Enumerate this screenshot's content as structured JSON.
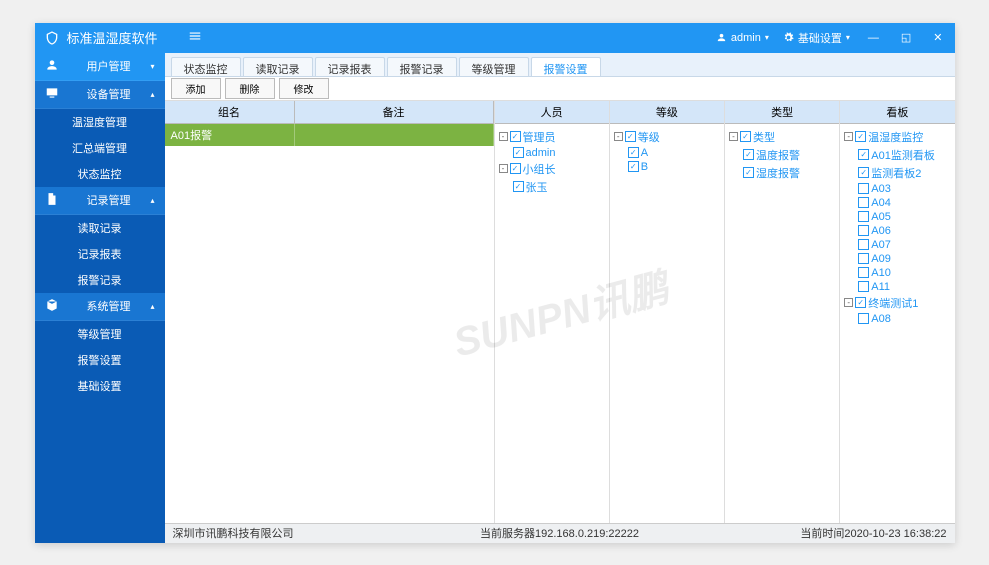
{
  "header": {
    "title": "标准温湿度软件",
    "user": "admin",
    "settings": "基础设置"
  },
  "sidebar": [
    {
      "type": "group",
      "icon": "users",
      "label": "用户管理",
      "expanded": false,
      "active": true
    },
    {
      "type": "group",
      "icon": "monitor",
      "label": "设备管理",
      "expanded": true,
      "items": [
        "温湿度管理",
        "汇总端管理",
        "状态监控"
      ]
    },
    {
      "type": "group",
      "icon": "file",
      "label": "记录管理",
      "expanded": true,
      "items": [
        "读取记录",
        "记录报表",
        "报警记录"
      ]
    },
    {
      "type": "group",
      "icon": "cube",
      "label": "系统管理",
      "expanded": true,
      "items": [
        "等级管理",
        "报警设置",
        "基础设置"
      ]
    }
  ],
  "tabs": [
    "状态监控",
    "读取记录",
    "记录报表",
    "报警记录",
    "等级管理",
    "报警设置"
  ],
  "activeTab": 5,
  "toolbar": [
    "添加",
    "删除",
    "修改"
  ],
  "grid": {
    "headers": [
      "组名",
      "备注"
    ],
    "rows": [
      {
        "name": "A01报警",
        "remark": ""
      }
    ]
  },
  "panels": [
    {
      "title": "人员",
      "tree": [
        {
          "label": "管理员",
          "checked": true,
          "exp": "-",
          "children": [
            {
              "label": "admin",
              "checked": true
            }
          ]
        },
        {
          "label": "小组长",
          "checked": true,
          "exp": "-",
          "children": [
            {
              "label": "张玉",
              "checked": true
            }
          ]
        }
      ]
    },
    {
      "title": "等级",
      "tree": [
        {
          "label": "等级",
          "checked": true,
          "exp": "-",
          "children": [
            {
              "label": "A",
              "checked": true
            },
            {
              "label": "B",
              "checked": true
            }
          ]
        }
      ]
    },
    {
      "title": "类型",
      "tree": [
        {
          "label": "类型",
          "checked": true,
          "exp": "-",
          "children": [
            {
              "label": "温度报警",
              "checked": true
            },
            {
              "label": "湿度报警",
              "checked": true
            }
          ]
        }
      ]
    },
    {
      "title": "看板",
      "tree": [
        {
          "label": "温湿度监控",
          "checked": true,
          "exp": "-",
          "children": [
            {
              "label": "A01监测看板",
              "checked": true
            },
            {
              "label": "监测看板2",
              "checked": true
            },
            {
              "label": "A03",
              "checked": false
            },
            {
              "label": "A04",
              "checked": false
            },
            {
              "label": "A05",
              "checked": false
            },
            {
              "label": "A06",
              "checked": false
            },
            {
              "label": "A07",
              "checked": false
            },
            {
              "label": "A09",
              "checked": false
            },
            {
              "label": "A10",
              "checked": false
            },
            {
              "label": "A11",
              "checked": false
            }
          ]
        },
        {
          "label": "终端测试1",
          "checked": true,
          "exp": "-",
          "children": [
            {
              "label": "A08",
              "checked": false
            }
          ]
        }
      ]
    }
  ],
  "footer": {
    "company": "深圳市讯鹏科技有限公司",
    "server": "当前服务器192.168.0.219:22222",
    "time": "当前时间2020-10-23 16:38:22"
  },
  "watermark": "SUNPN讯鹏"
}
